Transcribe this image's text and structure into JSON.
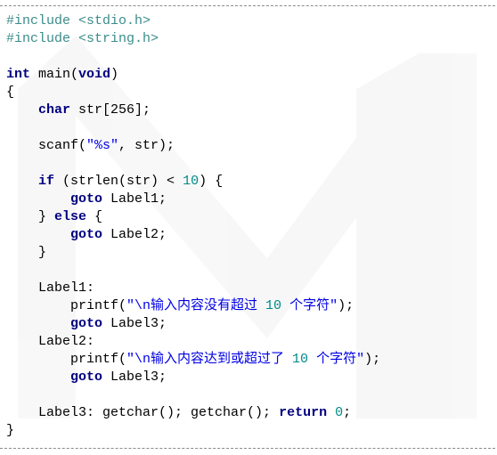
{
  "colors": {
    "preprocessor": "#3c8d8a",
    "keyword": "#000080",
    "string": "#0000e6",
    "number": "#008a8a",
    "text": "#000000",
    "rule": "#8a8a8a"
  },
  "code": {
    "lines": [
      [
        {
          "t": "pp",
          "v": "#include <stdio.h>"
        }
      ],
      [
        {
          "t": "pp",
          "v": "#include <string.h>"
        }
      ],
      [],
      [
        {
          "t": "kw",
          "v": "int"
        },
        {
          "t": "plain",
          "v": " main("
        },
        {
          "t": "kw",
          "v": "void"
        },
        {
          "t": "plain",
          "v": ")"
        }
      ],
      [
        {
          "t": "plain",
          "v": "{"
        }
      ],
      [
        {
          "t": "plain",
          "v": "    "
        },
        {
          "t": "kw",
          "v": "char"
        },
        {
          "t": "plain",
          "v": " str[256];"
        }
      ],
      [],
      [
        {
          "t": "plain",
          "v": "    scanf("
        },
        {
          "t": "str",
          "v": "\"%s\""
        },
        {
          "t": "plain",
          "v": ", str);"
        }
      ],
      [],
      [
        {
          "t": "plain",
          "v": "    "
        },
        {
          "t": "kw",
          "v": "if"
        },
        {
          "t": "plain",
          "v": " (strlen(str) < "
        },
        {
          "t": "num",
          "v": "10"
        },
        {
          "t": "plain",
          "v": ") {"
        }
      ],
      [
        {
          "t": "plain",
          "v": "        "
        },
        {
          "t": "kw",
          "v": "goto"
        },
        {
          "t": "plain",
          "v": " Label1;"
        }
      ],
      [
        {
          "t": "plain",
          "v": "    } "
        },
        {
          "t": "kw",
          "v": "else"
        },
        {
          "t": "plain",
          "v": " {"
        }
      ],
      [
        {
          "t": "plain",
          "v": "        "
        },
        {
          "t": "kw",
          "v": "goto"
        },
        {
          "t": "plain",
          "v": " Label2;"
        }
      ],
      [
        {
          "t": "plain",
          "v": "    }"
        }
      ],
      [],
      [
        {
          "t": "plain",
          "v": "    Label1:"
        }
      ],
      [
        {
          "t": "plain",
          "v": "        printf("
        },
        {
          "t": "str",
          "v": "\"\\n输入内容没有超过 "
        },
        {
          "t": "num",
          "v": "10"
        },
        {
          "t": "str",
          "v": " 个字符\""
        },
        {
          "t": "plain",
          "v": ");"
        }
      ],
      [
        {
          "t": "plain",
          "v": "        "
        },
        {
          "t": "kw",
          "v": "goto"
        },
        {
          "t": "plain",
          "v": " Label3;"
        }
      ],
      [
        {
          "t": "plain",
          "v": "    Label2:"
        }
      ],
      [
        {
          "t": "plain",
          "v": "        printf("
        },
        {
          "t": "str",
          "v": "\"\\n输入内容达到或超过了 "
        },
        {
          "t": "num",
          "v": "10"
        },
        {
          "t": "str",
          "v": " 个字符\""
        },
        {
          "t": "plain",
          "v": ");"
        }
      ],
      [
        {
          "t": "plain",
          "v": "        "
        },
        {
          "t": "kw",
          "v": "goto"
        },
        {
          "t": "plain",
          "v": " Label3;"
        }
      ],
      [],
      [
        {
          "t": "plain",
          "v": "    Label3: getchar(); getchar(); "
        },
        {
          "t": "kw",
          "v": "return"
        },
        {
          "t": "plain",
          "v": " "
        },
        {
          "t": "num",
          "v": "0"
        },
        {
          "t": "plain",
          "v": ";"
        }
      ],
      [
        {
          "t": "plain",
          "v": "}"
        }
      ]
    ]
  }
}
